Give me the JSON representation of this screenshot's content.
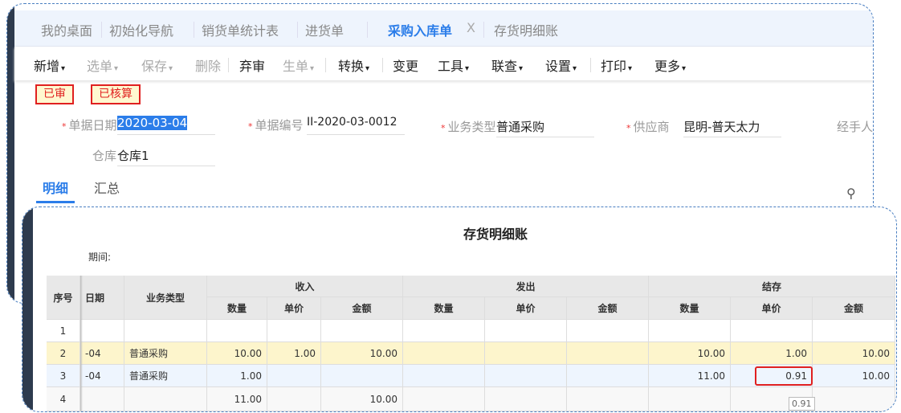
{
  "tabs": [
    "我的桌面",
    "初始化导航",
    "销货单统计表",
    "进货单",
    "采购入库单",
    "存货明细账"
  ],
  "tab_close": "X",
  "toolbar": [
    {
      "label": "新增",
      "chev": true,
      "disabled": false
    },
    {
      "label": "选单",
      "chev": true,
      "disabled": true
    },
    {
      "label": "保存",
      "chev": true,
      "disabled": true
    },
    {
      "label": "删除",
      "chev": false,
      "disabled": true
    },
    {
      "label": "弃审",
      "chev": false,
      "disabled": false
    },
    {
      "label": "生单",
      "chev": true,
      "disabled": true
    },
    {
      "label": "转换",
      "chev": true,
      "disabled": false
    },
    {
      "label": "变更",
      "chev": false,
      "disabled": false
    },
    {
      "label": "工具",
      "chev": true,
      "disabled": false
    },
    {
      "label": "联查",
      "chev": true,
      "disabled": false
    },
    {
      "label": "设置",
      "chev": true,
      "disabled": false
    },
    {
      "label": "打印",
      "chev": true,
      "disabled": false
    },
    {
      "label": "更多",
      "chev": true,
      "disabled": false
    }
  ],
  "badges": [
    "已审",
    "已核算"
  ],
  "form": {
    "date_label": "单据日期",
    "date": "2020-03-04",
    "no_label": "单据编号",
    "no": "II-2020-03-0012",
    "type_label": "业务类型",
    "type": "普通采购",
    "supplier_label": "供应商",
    "supplier": "昆明-普天太力",
    "handler_label": "经手人",
    "warehouse_label": "仓库",
    "warehouse": "仓库1",
    "required_mark": "*"
  },
  "subtabs": [
    "明细",
    "汇总"
  ],
  "report": {
    "title": "存货明细账",
    "period_label": "期间:",
    "headers": {
      "seq": "序号",
      "date": "日期",
      "type": "业务类型",
      "in": "收入",
      "out": "发出",
      "bal": "结存",
      "qty": "数量",
      "price": "单价",
      "amount": "金额"
    },
    "rows": [
      [
        "1",
        "",
        "",
        "",
        "",
        "",
        "",
        "",
        "",
        "",
        "",
        ""
      ],
      [
        "2",
        "-04",
        "普通采购",
        "10.00",
        "1.00",
        "10.00",
        "",
        "",
        "",
        "10.00",
        "1.00",
        "10.00"
      ],
      [
        "3",
        "-04",
        "普通采购",
        "1.00",
        "",
        "",
        "",
        "",
        "",
        "11.00",
        "0.91",
        "10.00"
      ],
      [
        "4",
        "",
        "",
        "11.00",
        "",
        "10.00",
        "",
        "",
        "",
        "",
        "",
        ""
      ]
    ],
    "tooltip": "0.91"
  }
}
